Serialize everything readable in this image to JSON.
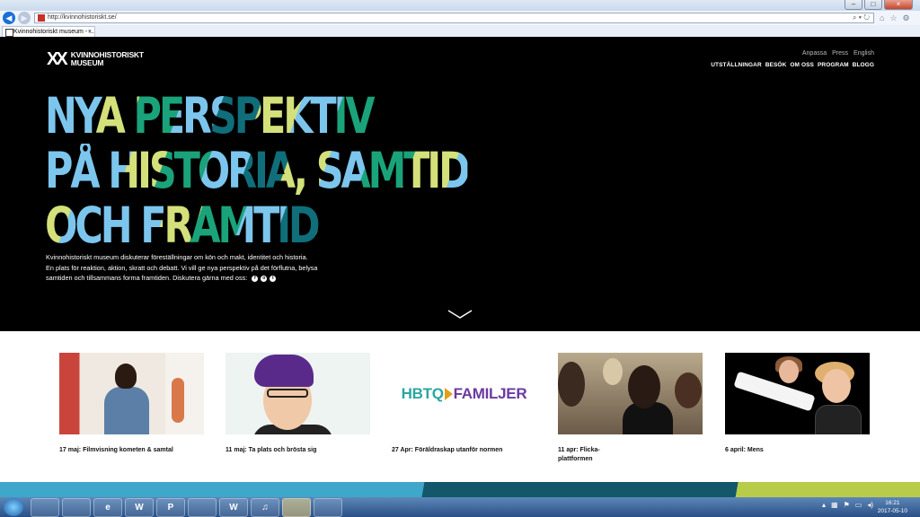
{
  "browser": {
    "url": "http://kvinnohistoriskt.se/",
    "tab_title": "Kvinnohistoriskt museum - ...",
    "tab_close": "×",
    "back_icon": "back-arrow-icon",
    "forward_icon": "forward-arrow-icon",
    "addr_tools": "⌕ ▾ ↻"
  },
  "site": {
    "logo_line1": "KVINNOHISTORISKT",
    "logo_line2": "MUSEUM",
    "util_links": [
      "Anpassa",
      "Press",
      "English"
    ],
    "nav": [
      "UTSTÄLLNINGAR",
      "BESÖK",
      "OM OSS",
      "PROGRAM",
      "BLOGG"
    ],
    "headline": [
      "NYA PERSPEKTIV",
      "PÅ HISTORIA, SAMTID",
      "OCH FRAMTID"
    ],
    "intro": [
      "Kvinnohistoriskt museum diskuterar föreställningar om kön och makt, identitet och historia.",
      "En plats för reaktion, aktion, skratt och debatt. Vi vill ge nya perspektiv på det förflutna, belysa",
      "samtiden och tillsammans forma framtiden. Diskutera gärna med oss:"
    ],
    "social_icons": [
      "facebook-icon",
      "instagram-icon",
      "twitter-icon"
    ]
  },
  "cards": [
    {
      "caption": "17 maj: Filmvisning kometen & samtal"
    },
    {
      "caption": "11 maj: Ta plats och brösta sig"
    },
    {
      "caption": "27 Apr: Föräldraskap utanför normen",
      "logo_left": "HBTQ",
      "logo_right": "FAMILJER"
    },
    {
      "caption": "11 apr: Flicka-plattformen"
    },
    {
      "caption": "6 april: Mens"
    }
  ],
  "taskbar": {
    "apps": [
      "",
      "",
      "e",
      "W",
      "P",
      "",
      "W",
      "♫",
      "",
      ""
    ],
    "clock_time": "16:21",
    "clock_date": "2017-05-10"
  },
  "colors": {
    "hero_bg": "#000000",
    "accent_blue": "#7cc6ee",
    "accent_green": "#1aa37a",
    "accent_yellow": "#d4e07a"
  }
}
